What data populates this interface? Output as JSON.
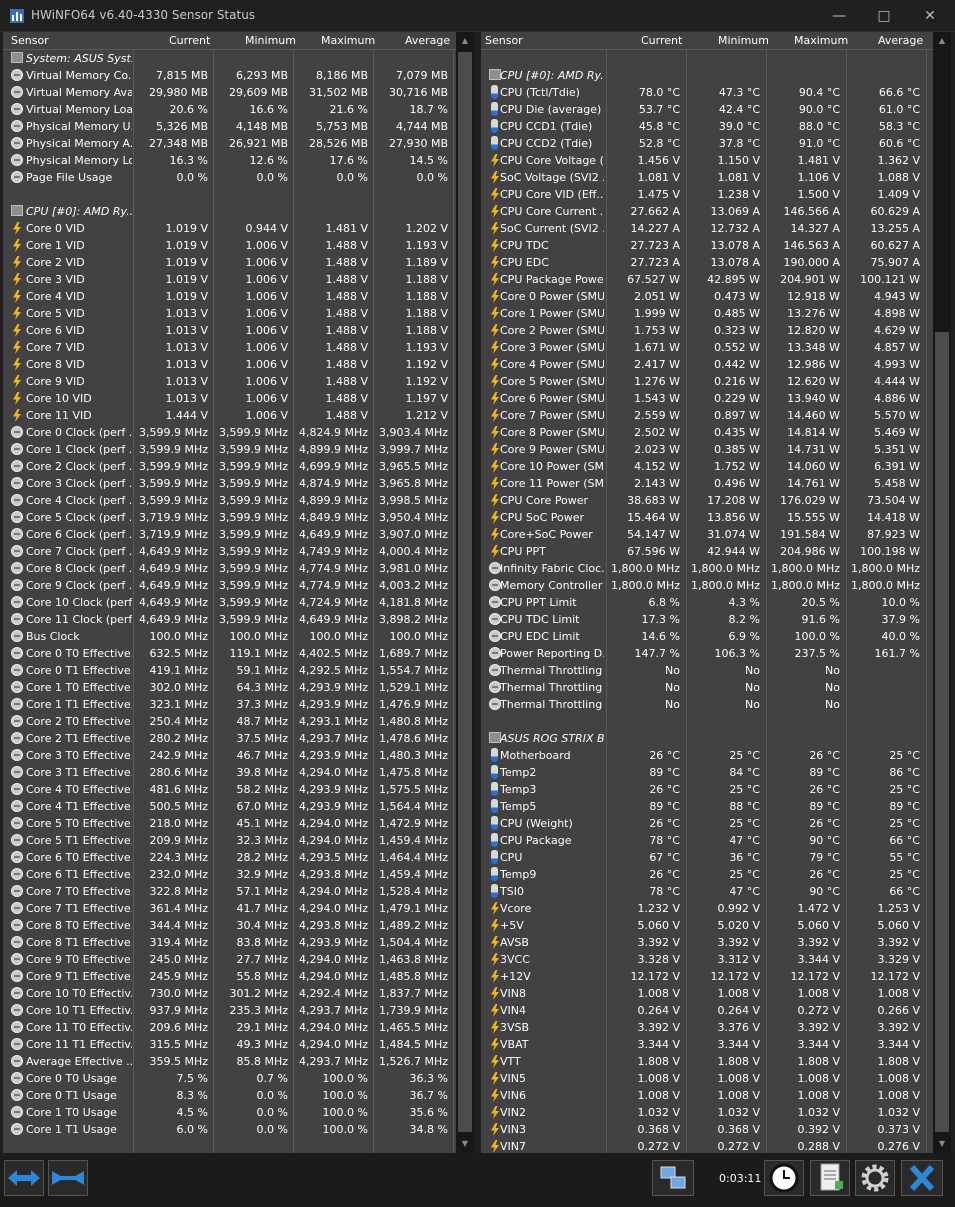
{
  "window": {
    "title": "HWiNFO64 v6.40-4330 Sensor Status"
  },
  "columns": [
    "Sensor",
    "Current",
    "Minimum",
    "Maximum",
    "Average"
  ],
  "left_rows": [
    {
      "t": "g",
      "n": "System: ASUS Syst..."
    },
    {
      "i": "clock",
      "n": "Virtual Memory Co...",
      "c": "7,815 MB",
      "mi": "6,293 MB",
      "ma": "8,186 MB",
      "a": "7,079 MB"
    },
    {
      "i": "clock",
      "n": "Virtual Memory Ava...",
      "c": "29,980 MB",
      "mi": "29,609 MB",
      "ma": "31,502 MB",
      "a": "30,716 MB"
    },
    {
      "i": "clock",
      "n": "Virtual Memory Load",
      "c": "20.6 %",
      "mi": "16.6 %",
      "ma": "21.6 %",
      "a": "18.7 %"
    },
    {
      "i": "clock",
      "n": "Physical Memory U...",
      "c": "5,326 MB",
      "mi": "4,148 MB",
      "ma": "5,753 MB",
      "a": "4,744 MB"
    },
    {
      "i": "clock",
      "n": "Physical Memory A...",
      "c": "27,348 MB",
      "mi": "26,921 MB",
      "ma": "28,526 MB",
      "a": "27,930 MB"
    },
    {
      "i": "clock",
      "n": "Physical Memory Load",
      "c": "16.3 %",
      "mi": "12.6 %",
      "ma": "17.6 %",
      "a": "14.5 %"
    },
    {
      "i": "clock",
      "n": "Page File Usage",
      "c": "0.0 %",
      "mi": "0.0 %",
      "ma": "0.0 %",
      "a": "0.0 %"
    },
    {
      "t": "gap"
    },
    {
      "t": "g",
      "n": "CPU [#0]: AMD Ry..."
    },
    {
      "i": "volt",
      "n": "Core 0 VID",
      "c": "1.019 V",
      "mi": "0.944 V",
      "ma": "1.481 V",
      "a": "1.202 V"
    },
    {
      "i": "volt",
      "n": "Core 1 VID",
      "c": "1.019 V",
      "mi": "1.006 V",
      "ma": "1.488 V",
      "a": "1.193 V"
    },
    {
      "i": "volt",
      "n": "Core 2 VID",
      "c": "1.019 V",
      "mi": "1.006 V",
      "ma": "1.488 V",
      "a": "1.189 V"
    },
    {
      "i": "volt",
      "n": "Core 3 VID",
      "c": "1.019 V",
      "mi": "1.006 V",
      "ma": "1.488 V",
      "a": "1.188 V"
    },
    {
      "i": "volt",
      "n": "Core 4 VID",
      "c": "1.019 V",
      "mi": "1.006 V",
      "ma": "1.488 V",
      "a": "1.188 V"
    },
    {
      "i": "volt",
      "n": "Core 5 VID",
      "c": "1.013 V",
      "mi": "1.006 V",
      "ma": "1.488 V",
      "a": "1.188 V"
    },
    {
      "i": "volt",
      "n": "Core 6 VID",
      "c": "1.013 V",
      "mi": "1.006 V",
      "ma": "1.488 V",
      "a": "1.188 V"
    },
    {
      "i": "volt",
      "n": "Core 7 VID",
      "c": "1.013 V",
      "mi": "1.006 V",
      "ma": "1.488 V",
      "a": "1.193 V"
    },
    {
      "i": "volt",
      "n": "Core 8 VID",
      "c": "1.013 V",
      "mi": "1.006 V",
      "ma": "1.488 V",
      "a": "1.192 V"
    },
    {
      "i": "volt",
      "n": "Core 9 VID",
      "c": "1.013 V",
      "mi": "1.006 V",
      "ma": "1.488 V",
      "a": "1.192 V"
    },
    {
      "i": "volt",
      "n": "Core 10 VID",
      "c": "1.013 V",
      "mi": "1.006 V",
      "ma": "1.488 V",
      "a": "1.197 V"
    },
    {
      "i": "volt",
      "n": "Core 11 VID",
      "c": "1.444 V",
      "mi": "1.006 V",
      "ma": "1.488 V",
      "a": "1.212 V"
    },
    {
      "i": "clock",
      "n": "Core 0 Clock (perf ...",
      "c": "3,599.9 MHz",
      "mi": "3,599.9 MHz",
      "ma": "4,824.9 MHz",
      "a": "3,903.4 MHz"
    },
    {
      "i": "clock",
      "n": "Core 1 Clock (perf ...",
      "c": "3,599.9 MHz",
      "mi": "3,599.9 MHz",
      "ma": "4,899.9 MHz",
      "a": "3,999.7 MHz"
    },
    {
      "i": "clock",
      "n": "Core 2 Clock (perf ...",
      "c": "3,599.9 MHz",
      "mi": "3,599.9 MHz",
      "ma": "4,699.9 MHz",
      "a": "3,965.5 MHz"
    },
    {
      "i": "clock",
      "n": "Core 3 Clock (perf ...",
      "c": "3,599.9 MHz",
      "mi": "3,599.9 MHz",
      "ma": "4,874.9 MHz",
      "a": "3,965.8 MHz"
    },
    {
      "i": "clock",
      "n": "Core 4 Clock (perf ...",
      "c": "3,599.9 MHz",
      "mi": "3,599.9 MHz",
      "ma": "4,899.9 MHz",
      "a": "3,998.5 MHz"
    },
    {
      "i": "clock",
      "n": "Core 5 Clock (perf ...",
      "c": "3,719.9 MHz",
      "mi": "3,599.9 MHz",
      "ma": "4,849.9 MHz",
      "a": "3,950.4 MHz"
    },
    {
      "i": "clock",
      "n": "Core 6 Clock (perf ...",
      "c": "3,719.9 MHz",
      "mi": "3,599.9 MHz",
      "ma": "4,649.9 MHz",
      "a": "3,907.0 MHz"
    },
    {
      "i": "clock",
      "n": "Core 7 Clock (perf ...",
      "c": "4,649.9 MHz",
      "mi": "3,599.9 MHz",
      "ma": "4,749.9 MHz",
      "a": "4,000.4 MHz"
    },
    {
      "i": "clock",
      "n": "Core 8 Clock (perf ...",
      "c": "4,649.9 MHz",
      "mi": "3,599.9 MHz",
      "ma": "4,774.9 MHz",
      "a": "3,981.0 MHz"
    },
    {
      "i": "clock",
      "n": "Core 9 Clock (perf ...",
      "c": "4,649.9 MHz",
      "mi": "3,599.9 MHz",
      "ma": "4,774.9 MHz",
      "a": "4,003.2 MHz"
    },
    {
      "i": "clock",
      "n": "Core 10 Clock (perf...",
      "c": "4,649.9 MHz",
      "mi": "3,599.9 MHz",
      "ma": "4,724.9 MHz",
      "a": "4,181.8 MHz"
    },
    {
      "i": "clock",
      "n": "Core 11 Clock (perf...",
      "c": "4,649.9 MHz",
      "mi": "3,599.9 MHz",
      "ma": "4,649.9 MHz",
      "a": "3,898.2 MHz"
    },
    {
      "i": "clock",
      "n": "Bus Clock",
      "c": "100.0 MHz",
      "mi": "100.0 MHz",
      "ma": "100.0 MHz",
      "a": "100.0 MHz"
    },
    {
      "i": "clock",
      "n": "Core 0 T0 Effective...",
      "c": "632.5 MHz",
      "mi": "119.1 MHz",
      "ma": "4,402.5 MHz",
      "a": "1,689.7 MHz"
    },
    {
      "i": "clock",
      "n": "Core 0 T1 Effective...",
      "c": "419.1 MHz",
      "mi": "59.1 MHz",
      "ma": "4,292.5 MHz",
      "a": "1,554.7 MHz"
    },
    {
      "i": "clock",
      "n": "Core 1 T0 Effective...",
      "c": "302.0 MHz",
      "mi": "64.3 MHz",
      "ma": "4,293.9 MHz",
      "a": "1,529.1 MHz"
    },
    {
      "i": "clock",
      "n": "Core 1 T1 Effective...",
      "c": "323.1 MHz",
      "mi": "37.3 MHz",
      "ma": "4,293.9 MHz",
      "a": "1,476.9 MHz"
    },
    {
      "i": "clock",
      "n": "Core 2 T0 Effective...",
      "c": "250.4 MHz",
      "mi": "48.7 MHz",
      "ma": "4,293.1 MHz",
      "a": "1,480.8 MHz"
    },
    {
      "i": "clock",
      "n": "Core 2 T1 Effective...",
      "c": "280.2 MHz",
      "mi": "37.5 MHz",
      "ma": "4,293.7 MHz",
      "a": "1,478.6 MHz"
    },
    {
      "i": "clock",
      "n": "Core 3 T0 Effective...",
      "c": "242.9 MHz",
      "mi": "46.7 MHz",
      "ma": "4,293.9 MHz",
      "a": "1,480.3 MHz"
    },
    {
      "i": "clock",
      "n": "Core 3 T1 Effective...",
      "c": "280.6 MHz",
      "mi": "39.8 MHz",
      "ma": "4,294.0 MHz",
      "a": "1,475.8 MHz"
    },
    {
      "i": "clock",
      "n": "Core 4 T0 Effective...",
      "c": "481.6 MHz",
      "mi": "58.2 MHz",
      "ma": "4,293.9 MHz",
      "a": "1,575.5 MHz"
    },
    {
      "i": "clock",
      "n": "Core 4 T1 Effective...",
      "c": "500.5 MHz",
      "mi": "67.0 MHz",
      "ma": "4,293.9 MHz",
      "a": "1,564.4 MHz"
    },
    {
      "i": "clock",
      "n": "Core 5 T0 Effective...",
      "c": "218.0 MHz",
      "mi": "45.1 MHz",
      "ma": "4,294.0 MHz",
      "a": "1,472.9 MHz"
    },
    {
      "i": "clock",
      "n": "Core 5 T1 Effective...",
      "c": "209.9 MHz",
      "mi": "32.3 MHz",
      "ma": "4,294.0 MHz",
      "a": "1,459.4 MHz"
    },
    {
      "i": "clock",
      "n": "Core 6 T0 Effective...",
      "c": "224.3 MHz",
      "mi": "28.2 MHz",
      "ma": "4,293.5 MHz",
      "a": "1,464.4 MHz"
    },
    {
      "i": "clock",
      "n": "Core 6 T1 Effective...",
      "c": "232.0 MHz",
      "mi": "32.9 MHz",
      "ma": "4,293.8 MHz",
      "a": "1,459.4 MHz"
    },
    {
      "i": "clock",
      "n": "Core 7 T0 Effective...",
      "c": "322.8 MHz",
      "mi": "57.1 MHz",
      "ma": "4,294.0 MHz",
      "a": "1,528.4 MHz"
    },
    {
      "i": "clock",
      "n": "Core 7 T1 Effective...",
      "c": "361.4 MHz",
      "mi": "41.7 MHz",
      "ma": "4,294.0 MHz",
      "a": "1,479.1 MHz"
    },
    {
      "i": "clock",
      "n": "Core 8 T0 Effective...",
      "c": "344.4 MHz",
      "mi": "30.4 MHz",
      "ma": "4,293.8 MHz",
      "a": "1,489.2 MHz"
    },
    {
      "i": "clock",
      "n": "Core 8 T1 Effective...",
      "c": "319.4 MHz",
      "mi": "83.8 MHz",
      "ma": "4,293.9 MHz",
      "a": "1,504.4 MHz"
    },
    {
      "i": "clock",
      "n": "Core 9 T0 Effective...",
      "c": "245.0 MHz",
      "mi": "27.7 MHz",
      "ma": "4,294.0 MHz",
      "a": "1,463.8 MHz"
    },
    {
      "i": "clock",
      "n": "Core 9 T1 Effective...",
      "c": "245.9 MHz",
      "mi": "55.8 MHz",
      "ma": "4,294.0 MHz",
      "a": "1,485.8 MHz"
    },
    {
      "i": "clock",
      "n": "Core 10 T0 Effectiv...",
      "c": "730.0 MHz",
      "mi": "301.2 MHz",
      "ma": "4,292.4 MHz",
      "a": "1,837.7 MHz"
    },
    {
      "i": "clock",
      "n": "Core 10 T1 Effectiv...",
      "c": "937.9 MHz",
      "mi": "235.3 MHz",
      "ma": "4,293.7 MHz",
      "a": "1,739.9 MHz"
    },
    {
      "i": "clock",
      "n": "Core 11 T0 Effectiv...",
      "c": "209.6 MHz",
      "mi": "29.1 MHz",
      "ma": "4,294.0 MHz",
      "a": "1,465.5 MHz"
    },
    {
      "i": "clock",
      "n": "Core 11 T1 Effectiv...",
      "c": "315.5 MHz",
      "mi": "49.3 MHz",
      "ma": "4,294.0 MHz",
      "a": "1,484.5 MHz"
    },
    {
      "i": "clock",
      "n": "Average Effective ...",
      "c": "359.5 MHz",
      "mi": "85.8 MHz",
      "ma": "4,293.7 MHz",
      "a": "1,526.7 MHz"
    },
    {
      "i": "clock",
      "n": "Core 0 T0 Usage",
      "c": "7.5 %",
      "mi": "0.7 %",
      "ma": "100.0 %",
      "a": "36.3 %"
    },
    {
      "i": "clock",
      "n": "Core 0 T1 Usage",
      "c": "8.3 %",
      "mi": "0.0 %",
      "ma": "100.0 %",
      "a": "36.7 %"
    },
    {
      "i": "clock",
      "n": "Core 1 T0 Usage",
      "c": "4.5 %",
      "mi": "0.0 %",
      "ma": "100.0 %",
      "a": "35.6 %"
    },
    {
      "i": "clock",
      "n": "Core 1 T1 Usage",
      "c": "6.0 %",
      "mi": "0.0 %",
      "ma": "100.0 %",
      "a": "34.8 %"
    }
  ],
  "right_rows": [
    {
      "t": "gap"
    },
    {
      "t": "g",
      "n": "CPU [#0]: AMD Ry..."
    },
    {
      "i": "temp",
      "n": "CPU (Tctl/Tdie)",
      "c": "78.0 °C",
      "mi": "47.3 °C",
      "ma": "90.4 °C",
      "a": "66.6 °C"
    },
    {
      "i": "temp",
      "n": "CPU Die (average)",
      "c": "53.7 °C",
      "mi": "42.4 °C",
      "ma": "90.0 °C",
      "a": "61.0 °C"
    },
    {
      "i": "temp",
      "n": "CPU CCD1 (Tdie)",
      "c": "45.8 °C",
      "mi": "39.0 °C",
      "ma": "88.0 °C",
      "a": "58.3 °C"
    },
    {
      "i": "temp",
      "n": "CPU CCD2 (Tdie)",
      "c": "52.8 °C",
      "mi": "37.8 °C",
      "ma": "91.0 °C",
      "a": "60.6 °C"
    },
    {
      "i": "volt",
      "n": "CPU Core Voltage (...",
      "c": "1.456 V",
      "mi": "1.150 V",
      "ma": "1.481 V",
      "a": "1.362 V"
    },
    {
      "i": "volt",
      "n": "SoC Voltage (SVI2 ...",
      "c": "1.081 V",
      "mi": "1.081 V",
      "ma": "1.106 V",
      "a": "1.088 V"
    },
    {
      "i": "volt",
      "n": "CPU Core VID (Eff...",
      "c": "1.475 V",
      "mi": "1.238 V",
      "ma": "1.500 V",
      "a": "1.409 V"
    },
    {
      "i": "volt",
      "n": "CPU Core Current ...",
      "c": "27.662 A",
      "mi": "13.069 A",
      "ma": "146.566 A",
      "a": "60.629 A"
    },
    {
      "i": "volt",
      "n": "SoC Current (SVI2 ...",
      "c": "14.227 A",
      "mi": "12.732 A",
      "ma": "14.327 A",
      "a": "13.255 A"
    },
    {
      "i": "volt",
      "n": "CPU TDC",
      "c": "27.723 A",
      "mi": "13.078 A",
      "ma": "146.563 A",
      "a": "60.627 A"
    },
    {
      "i": "volt",
      "n": "CPU EDC",
      "c": "27.723 A",
      "mi": "13.078 A",
      "ma": "190.000 A",
      "a": "75.907 A"
    },
    {
      "i": "volt",
      "n": "CPU Package Powe...",
      "c": "67.527 W",
      "mi": "42.895 W",
      "ma": "204.901 W",
      "a": "100.121 W"
    },
    {
      "i": "volt",
      "n": "Core 0 Power (SMU)",
      "c": "2.051 W",
      "mi": "0.473 W",
      "ma": "12.918 W",
      "a": "4.943 W"
    },
    {
      "i": "volt",
      "n": "Core 1 Power (SMU)",
      "c": "1.999 W",
      "mi": "0.485 W",
      "ma": "13.276 W",
      "a": "4.898 W"
    },
    {
      "i": "volt",
      "n": "Core 2 Power (SMU)",
      "c": "1.753 W",
      "mi": "0.323 W",
      "ma": "12.820 W",
      "a": "4.629 W"
    },
    {
      "i": "volt",
      "n": "Core 3 Power (SMU)",
      "c": "1.671 W",
      "mi": "0.552 W",
      "ma": "13.348 W",
      "a": "4.857 W"
    },
    {
      "i": "volt",
      "n": "Core 4 Power (SMU)",
      "c": "2.417 W",
      "mi": "0.442 W",
      "ma": "12.986 W",
      "a": "4.993 W"
    },
    {
      "i": "volt",
      "n": "Core 5 Power (SMU)",
      "c": "1.276 W",
      "mi": "0.216 W",
      "ma": "12.620 W",
      "a": "4.444 W"
    },
    {
      "i": "volt",
      "n": "Core 6 Power (SMU)",
      "c": "1.543 W",
      "mi": "0.229 W",
      "ma": "13.940 W",
      "a": "4.886 W"
    },
    {
      "i": "volt",
      "n": "Core 7 Power (SMU)",
      "c": "2.559 W",
      "mi": "0.897 W",
      "ma": "14.460 W",
      "a": "5.570 W"
    },
    {
      "i": "volt",
      "n": "Core 8 Power (SMU)",
      "c": "2.502 W",
      "mi": "0.435 W",
      "ma": "14.814 W",
      "a": "5.469 W"
    },
    {
      "i": "volt",
      "n": "Core 9 Power (SMU)",
      "c": "2.023 W",
      "mi": "0.385 W",
      "ma": "14.731 W",
      "a": "5.351 W"
    },
    {
      "i": "volt",
      "n": "Core 10 Power (SMU)",
      "c": "4.152 W",
      "mi": "1.752 W",
      "ma": "14.060 W",
      "a": "6.391 W"
    },
    {
      "i": "volt",
      "n": "Core 11 Power (SMU)",
      "c": "2.143 W",
      "mi": "0.496 W",
      "ma": "14.761 W",
      "a": "5.458 W"
    },
    {
      "i": "volt",
      "n": "CPU Core Power",
      "c": "38.683 W",
      "mi": "17.208 W",
      "ma": "176.029 W",
      "a": "73.504 W"
    },
    {
      "i": "volt",
      "n": "CPU SoC Power",
      "c": "15.464 W",
      "mi": "13.856 W",
      "ma": "15.555 W",
      "a": "14.418 W"
    },
    {
      "i": "volt",
      "n": "Core+SoC Power",
      "c": "54.147 W",
      "mi": "31.074 W",
      "ma": "191.584 W",
      "a": "87.923 W"
    },
    {
      "i": "volt",
      "n": "CPU PPT",
      "c": "67.596 W",
      "mi": "42.944 W",
      "ma": "204.986 W",
      "a": "100.198 W"
    },
    {
      "i": "clock",
      "n": "Infinity Fabric Cloc...",
      "c": "1,800.0 MHz",
      "mi": "1,800.0 MHz",
      "ma": "1,800.0 MHz",
      "a": "1,800.0 MHz"
    },
    {
      "i": "clock",
      "n": "Memory Controller ...",
      "c": "1,800.0 MHz",
      "mi": "1,800.0 MHz",
      "ma": "1,800.0 MHz",
      "a": "1,800.0 MHz"
    },
    {
      "i": "clock",
      "n": "CPU PPT Limit",
      "c": "6.8 %",
      "mi": "4.3 %",
      "ma": "20.5 %",
      "a": "10.0 %"
    },
    {
      "i": "clock",
      "n": "CPU TDC Limit",
      "c": "17.3 %",
      "mi": "8.2 %",
      "ma": "91.6 %",
      "a": "37.9 %"
    },
    {
      "i": "clock",
      "n": "CPU EDC Limit",
      "c": "14.6 %",
      "mi": "6.9 %",
      "ma": "100.0 %",
      "a": "40.0 %"
    },
    {
      "i": "clock",
      "n": "Power Reporting D...",
      "c": "147.7 %",
      "mi": "106.3 %",
      "ma": "237.5 %",
      "a": "161.7 %"
    },
    {
      "i": "clock",
      "n": "Thermal Throttling ...",
      "c": "No",
      "mi": "No",
      "ma": "No",
      "a": ""
    },
    {
      "i": "clock",
      "n": "Thermal Throttling ...",
      "c": "No",
      "mi": "No",
      "ma": "No",
      "a": ""
    },
    {
      "i": "clock",
      "n": "Thermal Throttling ...",
      "c": "No",
      "mi": "No",
      "ma": "No",
      "a": ""
    },
    {
      "t": "gap"
    },
    {
      "t": "g",
      "n": "ASUS ROG STRIX B..."
    },
    {
      "i": "temp",
      "n": "Motherboard",
      "c": "26 °C",
      "mi": "25 °C",
      "ma": "26 °C",
      "a": "25 °C"
    },
    {
      "i": "temp",
      "n": "Temp2",
      "c": "89 °C",
      "mi": "84 °C",
      "ma": "89 °C",
      "a": "86 °C"
    },
    {
      "i": "temp",
      "n": "Temp3",
      "c": "26 °C",
      "mi": "25 °C",
      "ma": "26 °C",
      "a": "25 °C"
    },
    {
      "i": "temp",
      "n": "Temp5",
      "c": "89 °C",
      "mi": "88 °C",
      "ma": "89 °C",
      "a": "89 °C"
    },
    {
      "i": "temp",
      "n": "CPU (Weight)",
      "c": "26 °C",
      "mi": "25 °C",
      "ma": "26 °C",
      "a": "25 °C"
    },
    {
      "i": "temp",
      "n": "CPU Package",
      "c": "78 °C",
      "mi": "47 °C",
      "ma": "90 °C",
      "a": "66 °C"
    },
    {
      "i": "temp",
      "n": "CPU",
      "c": "67 °C",
      "mi": "36 °C",
      "ma": "79 °C",
      "a": "55 °C"
    },
    {
      "i": "temp",
      "n": "Temp9",
      "c": "26 °C",
      "mi": "25 °C",
      "ma": "26 °C",
      "a": "25 °C"
    },
    {
      "i": "temp",
      "n": "TSI0",
      "c": "78 °C",
      "mi": "47 °C",
      "ma": "90 °C",
      "a": "66 °C"
    },
    {
      "i": "volt",
      "n": "Vcore",
      "c": "1.232 V",
      "mi": "0.992 V",
      "ma": "1.472 V",
      "a": "1.253 V"
    },
    {
      "i": "volt",
      "n": "+5V",
      "c": "5.060 V",
      "mi": "5.020 V",
      "ma": "5.060 V",
      "a": "5.060 V"
    },
    {
      "i": "volt",
      "n": "AVSB",
      "c": "3.392 V",
      "mi": "3.392 V",
      "ma": "3.392 V",
      "a": "3.392 V"
    },
    {
      "i": "volt",
      "n": "3VCC",
      "c": "3.328 V",
      "mi": "3.312 V",
      "ma": "3.344 V",
      "a": "3.329 V"
    },
    {
      "i": "volt",
      "n": "+12V",
      "c": "12.172 V",
      "mi": "12.172 V",
      "ma": "12.172 V",
      "a": "12.172 V"
    },
    {
      "i": "volt",
      "n": "VIN8",
      "c": "1.008 V",
      "mi": "1.008 V",
      "ma": "1.008 V",
      "a": "1.008 V"
    },
    {
      "i": "volt",
      "n": "VIN4",
      "c": "0.264 V",
      "mi": "0.264 V",
      "ma": "0.272 V",
      "a": "0.266 V"
    },
    {
      "i": "volt",
      "n": "3VSB",
      "c": "3.392 V",
      "mi": "3.376 V",
      "ma": "3.392 V",
      "a": "3.392 V"
    },
    {
      "i": "volt",
      "n": "VBAT",
      "c": "3.344 V",
      "mi": "3.344 V",
      "ma": "3.344 V",
      "a": "3.344 V"
    },
    {
      "i": "volt",
      "n": "VTT",
      "c": "1.808 V",
      "mi": "1.808 V",
      "ma": "1.808 V",
      "a": "1.808 V"
    },
    {
      "i": "volt",
      "n": "VIN5",
      "c": "1.008 V",
      "mi": "1.008 V",
      "ma": "1.008 V",
      "a": "1.008 V"
    },
    {
      "i": "volt",
      "n": "VIN6",
      "c": "1.008 V",
      "mi": "1.008 V",
      "ma": "1.008 V",
      "a": "1.008 V"
    },
    {
      "i": "volt",
      "n": "VIN2",
      "c": "1.032 V",
      "mi": "1.032 V",
      "ma": "1.032 V",
      "a": "1.032 V"
    },
    {
      "i": "volt",
      "n": "VIN3",
      "c": "0.368 V",
      "mi": "0.368 V",
      "ma": "0.392 V",
      "a": "0.373 V"
    },
    {
      "i": "volt",
      "n": "VIN7",
      "c": "0.272 V",
      "mi": "0.272 V",
      "ma": "0.288 V",
      "a": "0.276 V"
    }
  ],
  "bottom": {
    "timer": "0:03:11"
  },
  "colors": {
    "panel": "#424242",
    "header": "#424242",
    "accent_blue": "#2f86d6",
    "volt": "#f3b41e"
  }
}
